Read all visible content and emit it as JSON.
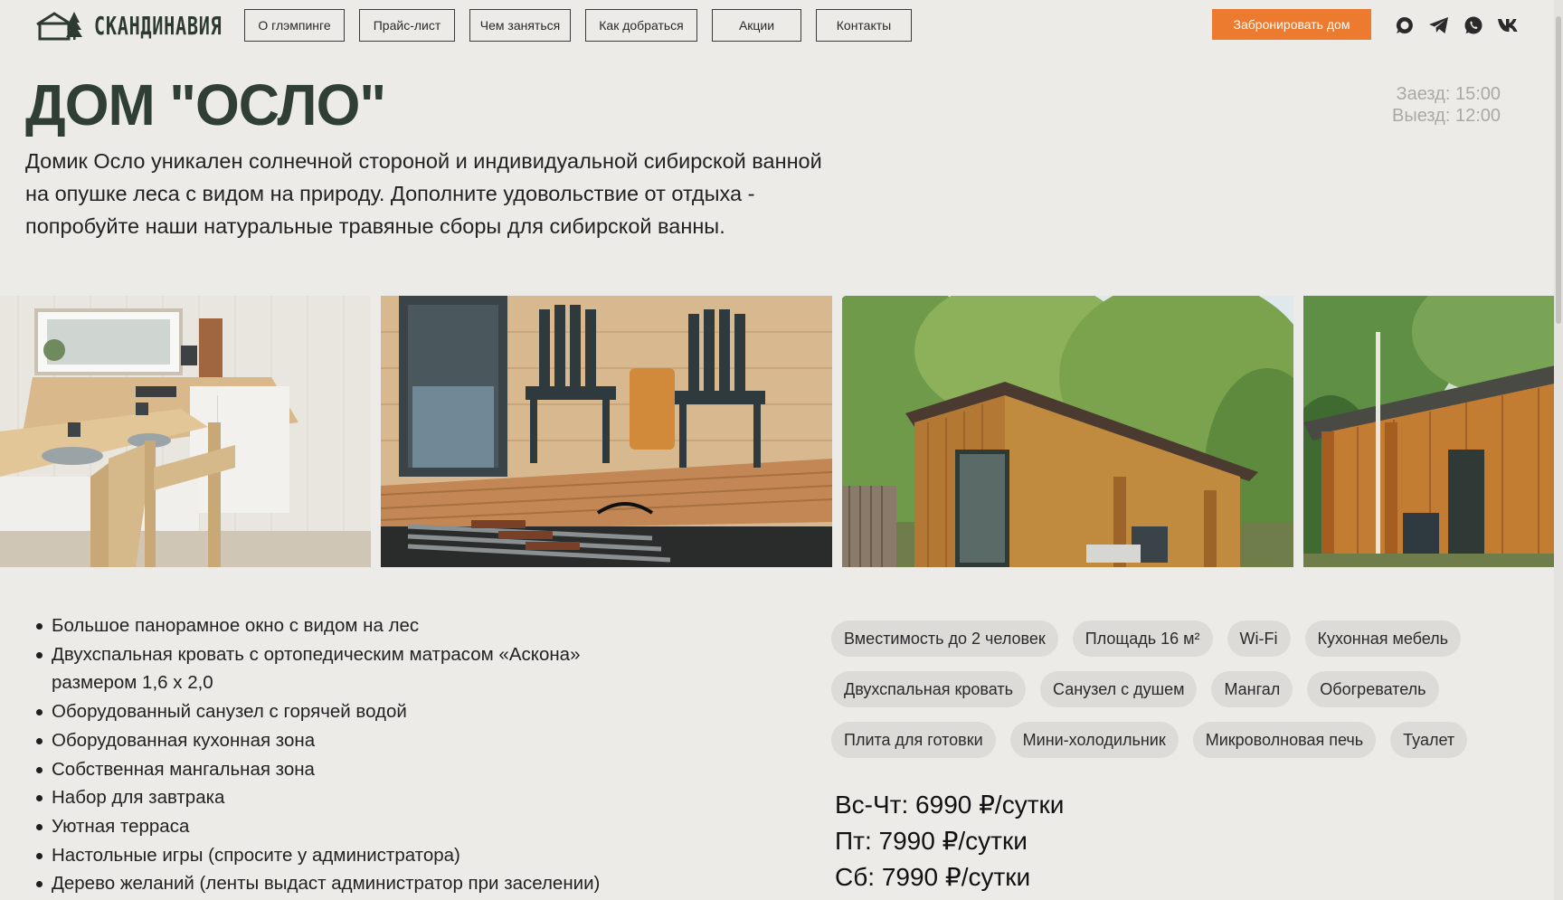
{
  "header": {
    "logo_text": "СКАНДИНАВИЯ",
    "nav": [
      {
        "label": "О глэмпинге",
        "name": "nav-about"
      },
      {
        "label": "Прайс-лист",
        "name": "nav-pricelist"
      },
      {
        "label": "Чем заняться",
        "name": "nav-activities"
      },
      {
        "label": "Как добраться",
        "name": "nav-directions"
      },
      {
        "label": "Акции",
        "name": "nav-promotions"
      },
      {
        "label": "Контакты",
        "name": "nav-contacts"
      }
    ],
    "book_label": "Забронировать дом",
    "socials": [
      "chat-bubble-icon",
      "telegram-icon",
      "whatsapp-icon",
      "vk-icon"
    ],
    "book_color": "#ec7a2f"
  },
  "page": {
    "title": "ДОМ \"ОСЛО\"",
    "checkin": "Заезд: 15:00",
    "checkout": "Выезд: 12:00",
    "description": "Домик Осло уникален солнечной стороной и индивидуальной сибирской ванной на опушке леса с видом на природу. Дополните удовольствие от отдыха - попробуйте наши натуральные травяные сборы для сибирской ванны."
  },
  "gallery": {
    "photos": [
      "kitchen-photo",
      "terrace-chairs-photo",
      "cabin-exterior-photo",
      "cabin-side-photo"
    ]
  },
  "features": [
    "Большое панорамное окно с видом на лес",
    "Двухспальная кровать с ортопедическим матрасом «Аскона» размером 1,6 x 2,0",
    "Оборудованный санузел с горячей водой",
    "Оборудованная кухонная зона",
    "Собственная мангальная зона",
    "Набор для завтрака",
    "Уютная терраса",
    "Настольные игры (спросите у администратора)",
    "Дерево желаний (ленты выдаст администратор при заселении)"
  ],
  "amenities": [
    "Вместимость до 2 человек",
    "Площадь 16 м²",
    "Wi-Fi",
    "Кухонная мебель",
    "Двухспальная кровать",
    "Санузел с душем",
    "Мангал",
    "Обогреватель",
    "Плита для готовки",
    "Мини-холодильник",
    "Микроволновая печь",
    "Туалет"
  ],
  "prices": [
    "Вс-Чт: 6990 ₽/сутки",
    "Пт: 7990 ₽/сутки",
    "Сб: 7990 ₽/сутки"
  ]
}
